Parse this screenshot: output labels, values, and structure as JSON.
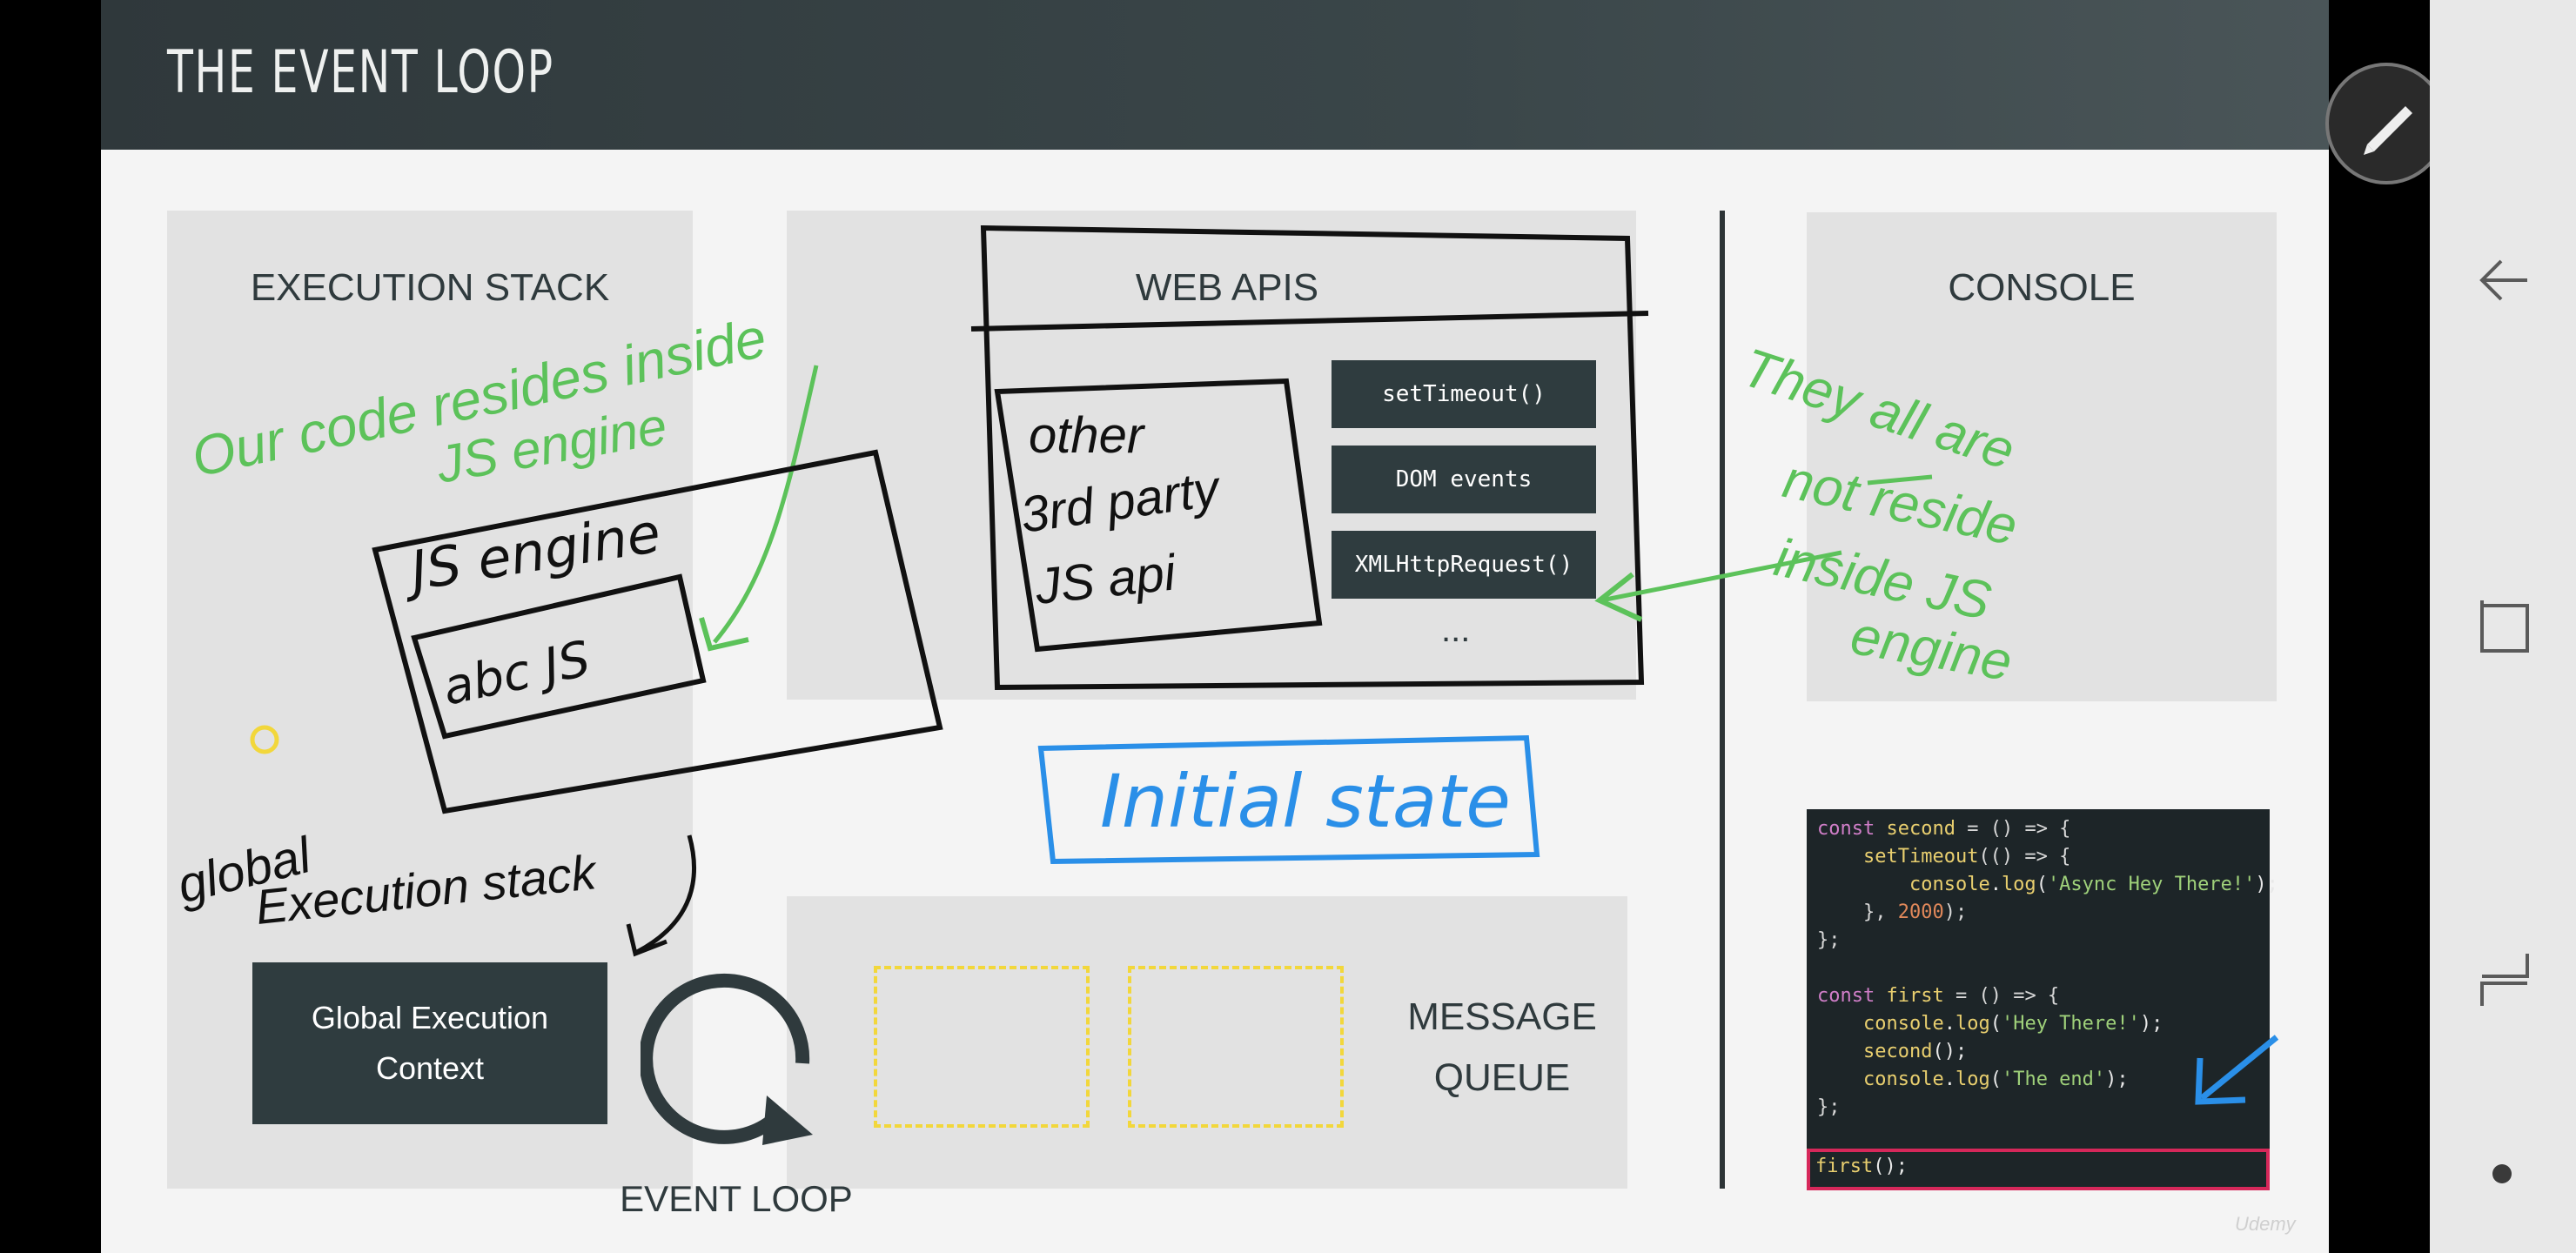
{
  "slide": {
    "title": "THE EVENT LOOP",
    "execution_stack": {
      "heading": "EXECUTION STACK",
      "context_box": "Global Execution Context"
    },
    "web_apis": {
      "heading": "WEB APIS",
      "items": [
        {
          "label": "setTimeout()"
        },
        {
          "label": "DOM events"
        },
        {
          "label": "XMLHttpRequest()"
        }
      ],
      "more": "..."
    },
    "console": {
      "heading": "CONSOLE"
    },
    "message_queue": {
      "heading_line1": "MESSAGE",
      "heading_line2": "QUEUE"
    },
    "event_loop": {
      "label": "EVENT LOOP"
    },
    "code": {
      "lines": [
        "const second = () => {",
        "    setTimeout(() => {",
        "        console.log('Async Hey There!');",
        "    }, 2000);",
        "};",
        "",
        "const first = () => {",
        "    console.log('Hey There!');",
        "    second();",
        "    console.log('The end');",
        "};"
      ],
      "current_call": "first();"
    },
    "watermark": "Udemy"
  },
  "annotations": {
    "green_note_1_line1": "Our code resides inside",
    "green_note_1_line2": "JS engine",
    "black_box_1": "JS engine",
    "black_box_1_inner": "abc JS",
    "black_box_2_lines": [
      "other",
      "3rd party",
      "JS api"
    ],
    "green_note_2_lines": [
      "They all are",
      "not reside",
      "inside JS",
      "engine"
    ],
    "blue_note": "Initial state",
    "black_note_lines": [
      "global",
      "Execution stack"
    ]
  },
  "colors": {
    "title_bar": "#35403f",
    "panel": "#e2e2e2",
    "dark_box": "#2f3c3f",
    "green_ink": "#5cc25a",
    "blue_ink": "#2a8fe8",
    "dashed_box": "#f2d73b",
    "highlight_border": "#d6285a"
  },
  "android_nav": {
    "icons": [
      "pencil-icon",
      "back-icon",
      "recents-icon",
      "overview-icon",
      "home-dot-icon"
    ]
  }
}
